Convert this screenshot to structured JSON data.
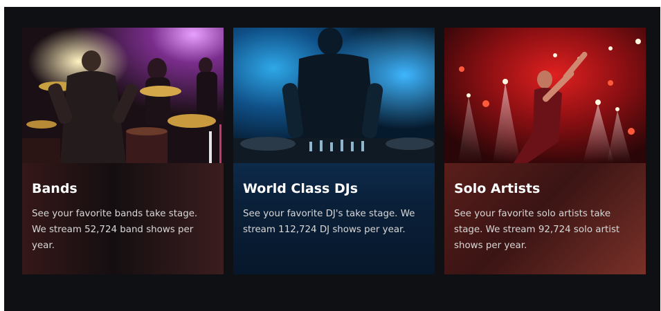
{
  "cards": [
    {
      "title": "Bands",
      "description": "See your favorite bands take stage. We stream 52,724 band shows per year.",
      "image": "band-drummer-photo"
    },
    {
      "title": "World Class DJs",
      "description": "See your favorite DJ's take stage. We stream 112,724 DJ shows per year.",
      "image": "dj-mixer-photo"
    },
    {
      "title": "Solo Artists",
      "description": "See your favorite solo artists take stage. We stream 92,724 solo artist shows per year.",
      "image": "solo-singer-photo"
    }
  ],
  "colors": {
    "page_background": "#0e1014",
    "bands_accent": "#7a2d8c",
    "djs_accent": "#1e7fd0",
    "solo_accent": "#c81e1e"
  }
}
